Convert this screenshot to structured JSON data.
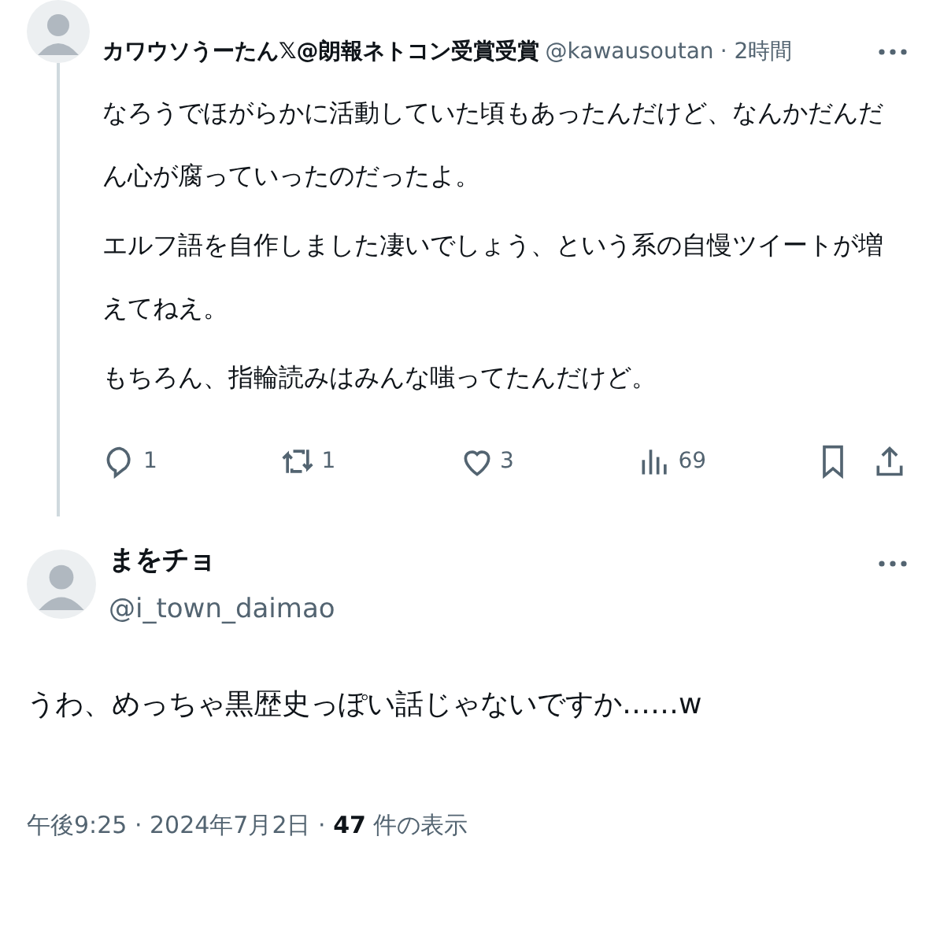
{
  "parent_tweet": {
    "display_name": "カワウソうーたん𝕏@朗報ネトコン受賞受賞",
    "handle": "@kawausoutan",
    "time": "· 2時間",
    "paragraphs": [
      "なろうでほがらかに活動していた頃もあったんだけど、なんかだんだん心が腐っていったのだったよ。",
      "エルフ語を自作しました凄いでしょう、という系の自慢ツイートが増えてねえ。",
      "もちろん、指輪読みはみんな嗤ってたんだけど。"
    ],
    "actions": [
      {
        "kind": "reply",
        "count": "1"
      },
      {
        "kind": "repost",
        "count": "1"
      },
      {
        "kind": "like",
        "count": "3"
      },
      {
        "kind": "views",
        "count": "69"
      }
    ]
  },
  "reply_tweet": {
    "display_name": "まをチョ",
    "handle": "@i_town_daimao",
    "text": "うわ、めっちゃ黒歴史っぽい話じゃないですか……w",
    "meta": "午後9:25 · 2024年7月2日 · **47** 件の表示"
  }
}
